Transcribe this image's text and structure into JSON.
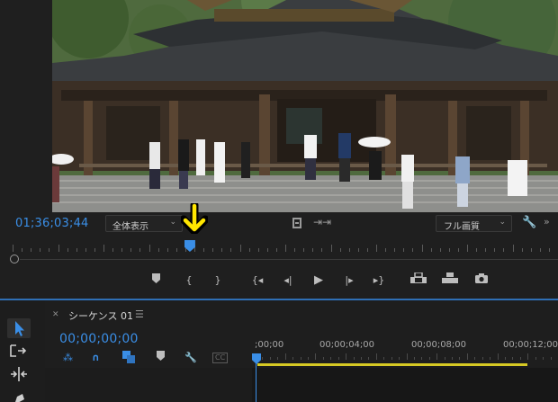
{
  "program_monitor": {
    "timecode": "01;36;03;44",
    "fit_select": "全体表示",
    "quality_select": "フル画質",
    "playhead_position": 0.325
  },
  "sequence": {
    "tab_title": "シーケンス 01",
    "timecode": "00;00;00;00",
    "ruler_labels": [
      ";00;00",
      "00;00;04;00",
      "00;00;08;00",
      "00;00;12;00"
    ]
  },
  "icons": {
    "monitor_controls": [
      "safe-margin-icon",
      "export-frame-arrow-icon",
      "settings-wrench-icon"
    ],
    "transport": [
      "add-marker-icon",
      "mark-in-icon",
      "mark-out-icon",
      "go-to-in-icon",
      "step-back-icon",
      "play-icon",
      "step-forward-icon",
      "go-to-out-icon",
      "lift-icon",
      "extract-icon",
      "export-frame-icon"
    ],
    "tools": [
      "selection-tool-icon",
      "ripple-edit-tool-icon",
      "razor-tool-icon",
      "pen-tool-icon"
    ],
    "sequence_tools": [
      "snap-icon",
      "linked-selection-icon",
      "add-marker-icon",
      "settings-wrench-icon",
      "captions-icon"
    ]
  },
  "colors": {
    "accent_blue": "#3a8ee6",
    "annotation_yellow": "#ffe600",
    "work_area_yellow": "#d6c924"
  }
}
